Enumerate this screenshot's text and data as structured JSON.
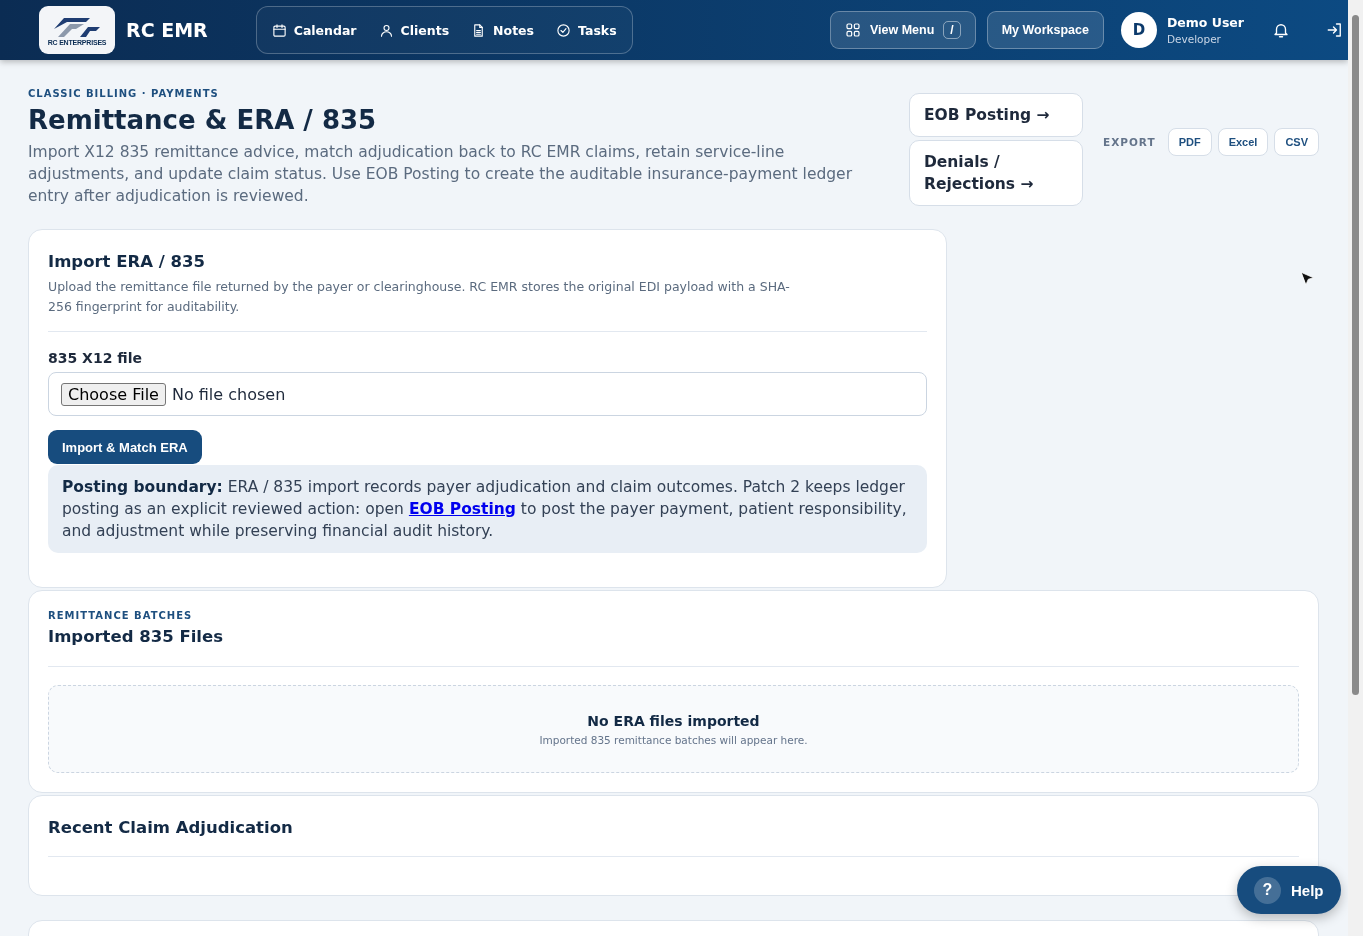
{
  "header": {
    "logo_text": "RC ENTERPRISES",
    "app_name": "RC EMR",
    "nav": [
      {
        "label": "Calendar"
      },
      {
        "label": "Clients"
      },
      {
        "label": "Notes"
      },
      {
        "label": "Tasks"
      }
    ],
    "view_menu": {
      "label": "View Menu",
      "shortcut": "/"
    },
    "workspace_button": "My Workspace",
    "user": {
      "initial": "D",
      "name": "Demo User",
      "role": "Developer"
    }
  },
  "page": {
    "breadcrumb": "CLASSIC BILLING · PAYMENTS",
    "title": "Remittance & ERA / 835",
    "description": "Import X12 835 remittance advice, match adjudication back to RC EMR claims, retain service-line adjustments, and update claim status. Use EOB Posting to create the auditable insurance-payment ledger entry after adjudication is reviewed.",
    "links": [
      "EOB Posting →",
      "Denials / Rejections →"
    ],
    "export": {
      "label": "EXPORT",
      "buttons": [
        "PDF",
        "Excel",
        "CSV"
      ]
    }
  },
  "import_card": {
    "title": "Import ERA / 835",
    "description": "Upload the remittance file returned by the payer or clearinghouse. RC EMR stores the original EDI payload with a SHA-256 fingerprint for auditability.",
    "file_label": "835 X12 file",
    "file_button": "Choose File",
    "file_status": "No file chosen",
    "submit_button": "Import & Match ERA",
    "notice": {
      "before": "**Posting boundary:** ERA / 835 import records payer adjudication and claim outcomes. Patch 2 keeps ledger posting as an explicit reviewed action: open",
      "link": "EOB Posting",
      "after": "to post the payer payment, patient responsibility, and adjustment while preserving financial audit history."
    }
  },
  "batches_card": {
    "eyebrow": "REMITTANCE BATCHES",
    "title": "Imported 835 Files",
    "empty_title": "No ERA files imported",
    "empty_text": "Imported 835 remittance batches will appear here."
  },
  "recent_card": {
    "title": "Recent Claim Adjudication"
  },
  "help": {
    "icon": "?",
    "label": "Help"
  }
}
